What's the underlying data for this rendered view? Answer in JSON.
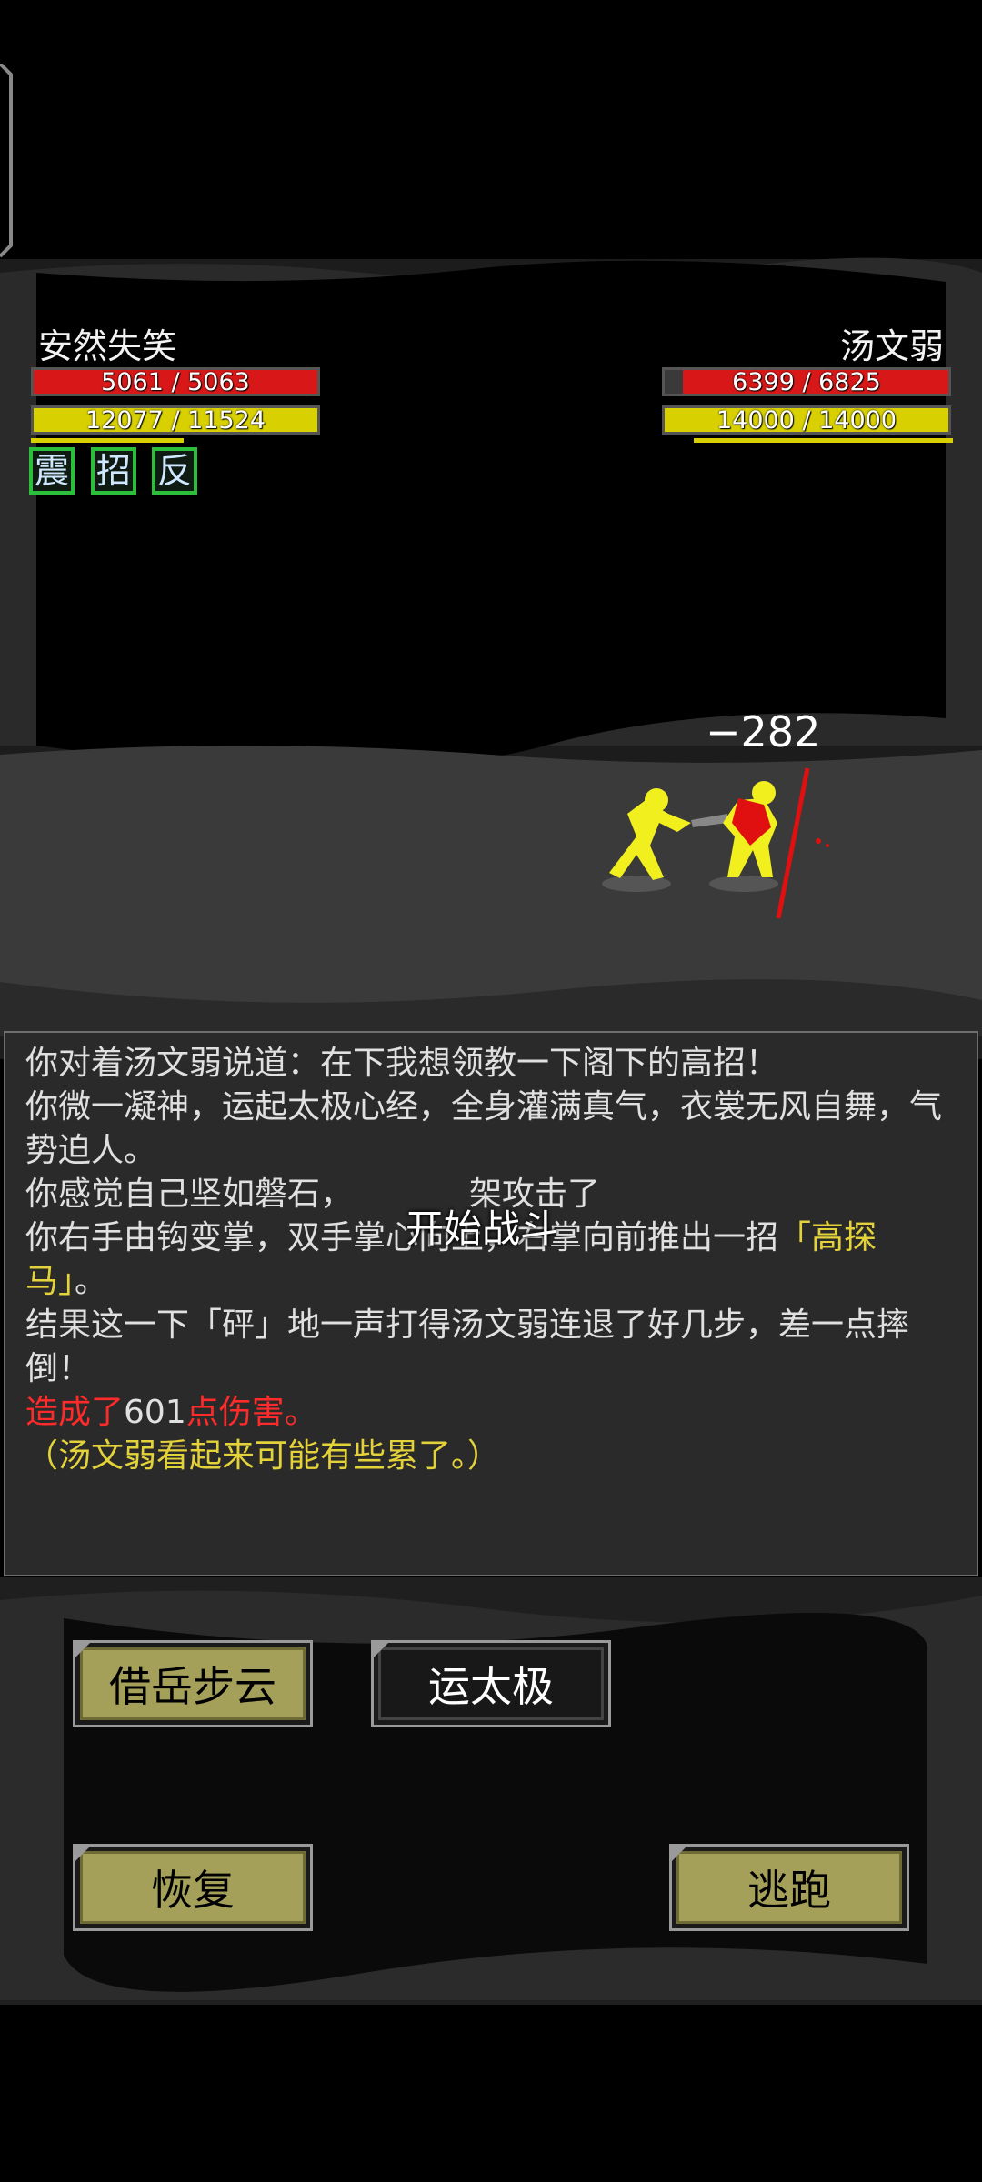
{
  "player": {
    "name": "安然失笑",
    "hp": "5061 / 5063",
    "hp_frac": 0.9996,
    "mp": "12077 / 11524",
    "mp_frac": 1.0
  },
  "enemy": {
    "name": "汤文弱",
    "hp": "6399 / 6825",
    "hp_frac": 0.9375,
    "mp": "14000 / 14000",
    "mp_frac": 1.0
  },
  "status_badges": [
    "震",
    "招",
    "反"
  ],
  "damage_popup": "−282",
  "overlay_text": "开始战斗",
  "log": {
    "line1": "你对着汤文弱说道：在下我想领教一下阁下的高招！",
    "line2": "你微一凝神，运起太极心经，全身灌满真气，衣裳无风自舞，气势迫人。",
    "line3": "你感觉自己坚如磐石，",
    "line3_tail": "架攻击了",
    "line4_a": "你右手由钩变掌，双手掌心向上，右掌向前推出一招",
    "line4_b": "「高探马」",
    "line4_c": "。",
    "line5": "结果这一下「砰」地一声打得汤文弱连退了好几步，差一点摔倒！",
    "line6_a": "造成了",
    "line6_b": "601",
    "line6_c": "点伤害。",
    "line7": "（汤文弱看起来可能有些累了。）"
  },
  "buttons": {
    "skill1": "借岳步云",
    "skill2": "运太极",
    "recover": "恢复",
    "flee": "逃跑"
  },
  "colors": {
    "hp_bar": "#d81818",
    "mp_bar": "#d8d000",
    "log_yellow": "#e4d23a",
    "log_red": "#ff2a2a",
    "button_olive": "#a4a05a"
  }
}
